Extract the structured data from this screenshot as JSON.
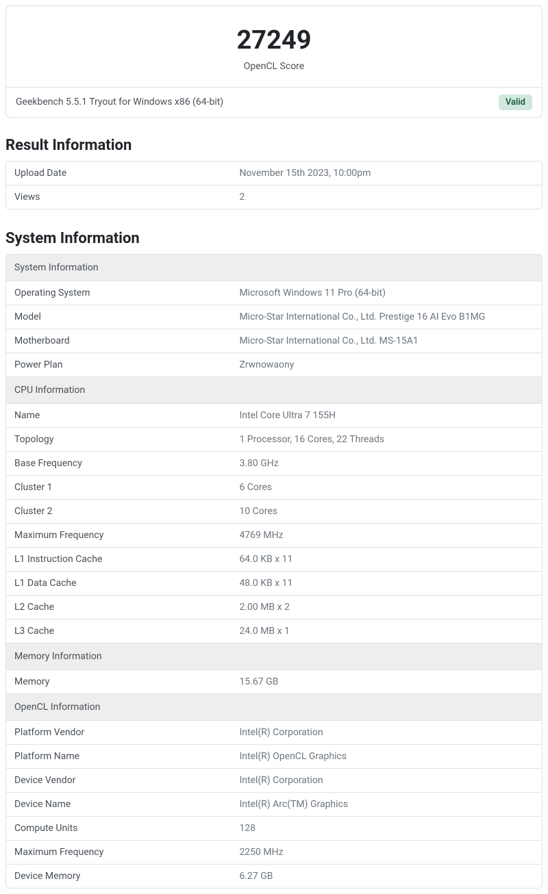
{
  "score": {
    "value": "27249",
    "label": "OpenCL Score"
  },
  "version": "Geekbench 5.5.1 Tryout for Windows x86 (64-bit)",
  "status_badge": "Valid",
  "result_info": {
    "heading": "Result Information",
    "rows": [
      {
        "label": "Upload Date",
        "value": "November 15th 2023, 10:00pm"
      },
      {
        "label": "Views",
        "value": "2"
      }
    ]
  },
  "system_info": {
    "heading": "System Information",
    "sections": [
      {
        "title": "System Information",
        "rows": [
          {
            "label": "Operating System",
            "value": "Microsoft Windows 11 Pro (64-bit)"
          },
          {
            "label": "Model",
            "value": "Micro-Star International Co., Ltd. Prestige 16 AI Evo B1MG"
          },
          {
            "label": "Motherboard",
            "value": "Micro-Star International Co., Ltd. MS-15A1"
          },
          {
            "label": "Power Plan",
            "value": "Zrwnowaony"
          }
        ]
      },
      {
        "title": "CPU Information",
        "rows": [
          {
            "label": "Name",
            "value": "Intel Core Ultra 7 155H"
          },
          {
            "label": "Topology",
            "value": "1 Processor, 16 Cores, 22 Threads"
          },
          {
            "label": "Base Frequency",
            "value": "3.80 GHz"
          },
          {
            "label": "Cluster 1",
            "value": "6 Cores"
          },
          {
            "label": "Cluster 2",
            "value": "10 Cores"
          },
          {
            "label": "Maximum Frequency",
            "value": "4769 MHz"
          },
          {
            "label": "L1 Instruction Cache",
            "value": "64.0 KB x 11"
          },
          {
            "label": "L1 Data Cache",
            "value": "48.0 KB x 11"
          },
          {
            "label": "L2 Cache",
            "value": "2.00 MB x 2"
          },
          {
            "label": "L3 Cache",
            "value": "24.0 MB x 1"
          }
        ]
      },
      {
        "title": "Memory Information",
        "rows": [
          {
            "label": "Memory",
            "value": "15.67 GB"
          }
        ]
      },
      {
        "title": "OpenCL Information",
        "rows": [
          {
            "label": "Platform Vendor",
            "value": "Intel(R) Corporation"
          },
          {
            "label": "Platform Name",
            "value": "Intel(R) OpenCL Graphics"
          },
          {
            "label": "Device Vendor",
            "value": "Intel(R) Corporation"
          },
          {
            "label": "Device Name",
            "value": "Intel(R) Arc(TM) Graphics"
          },
          {
            "label": "Compute Units",
            "value": "128"
          },
          {
            "label": "Maximum Frequency",
            "value": "2250 MHz"
          },
          {
            "label": "Device Memory",
            "value": "6.27 GB"
          }
        ]
      }
    ]
  }
}
